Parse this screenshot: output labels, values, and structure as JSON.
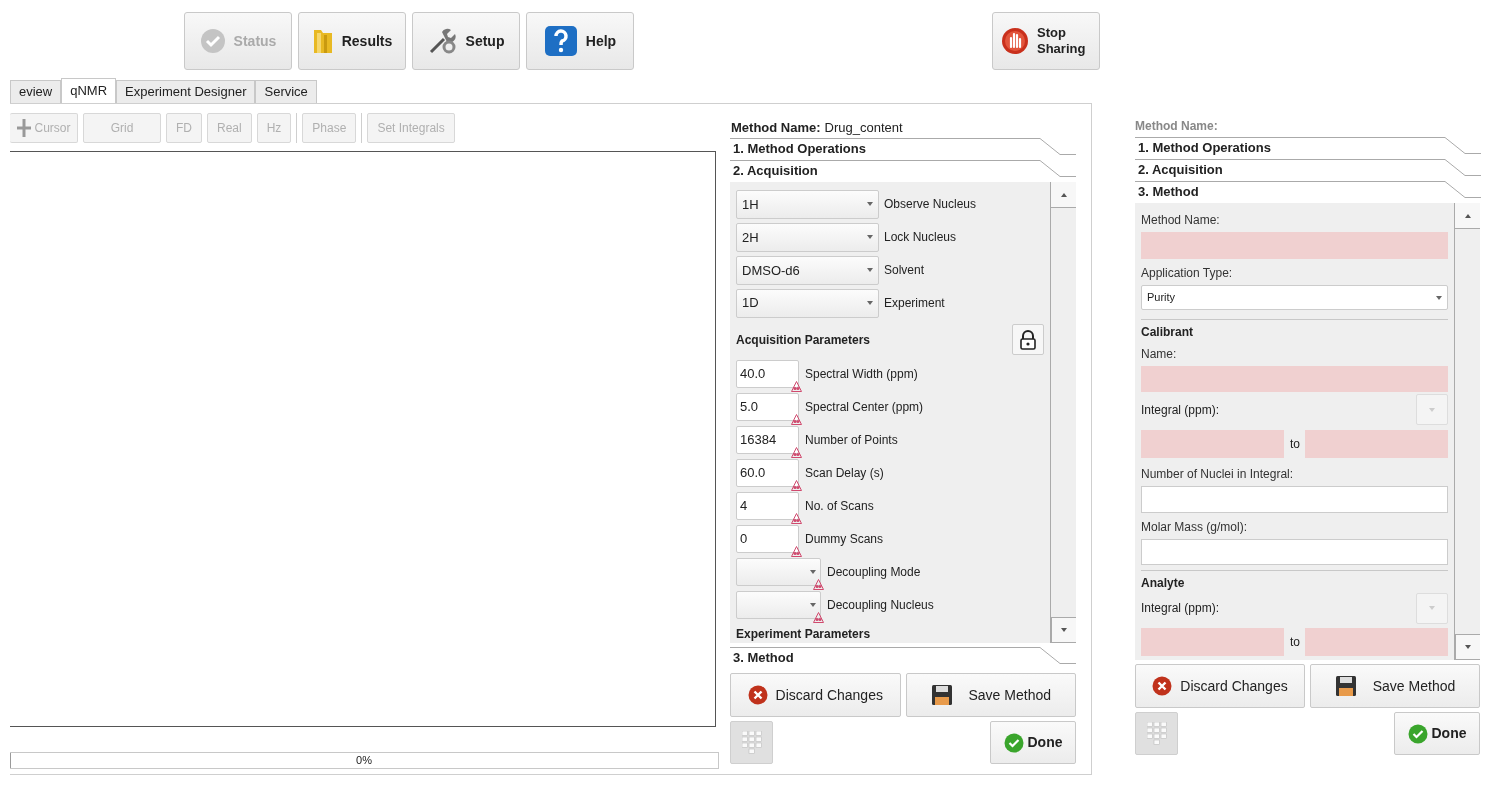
{
  "top_buttons": [
    {
      "kind": "status",
      "label": "Status",
      "disabled": true
    },
    {
      "kind": "results",
      "label": "Results",
      "disabled": false
    },
    {
      "kind": "setup",
      "label": "Setup",
      "disabled": false
    },
    {
      "kind": "help",
      "label": "Help",
      "disabled": false
    }
  ],
  "stop_sharing": {
    "label": "Stop Sharing"
  },
  "tabs": [
    {
      "label": "eview",
      "selected": false
    },
    {
      "label": "qNMR",
      "selected": true
    },
    {
      "label": "Experiment Designer",
      "selected": false
    },
    {
      "label": "Service",
      "selected": false
    }
  ],
  "toolbar": [
    {
      "kind": "cursor",
      "label": "Cursor",
      "disabled": true,
      "separator_before": false
    },
    {
      "kind": "plain",
      "label": "Grid",
      "disabled": true,
      "separator_before": false
    },
    {
      "kind": "plain",
      "label": "FD",
      "disabled": true,
      "separator_before": false
    },
    {
      "kind": "plain",
      "label": "Real",
      "disabled": true,
      "separator_before": false
    },
    {
      "kind": "plain",
      "label": "Hz",
      "disabled": true,
      "separator_before": false
    },
    {
      "kind": "plain",
      "label": "Phase",
      "disabled": true,
      "separator_before": true
    },
    {
      "kind": "plain",
      "label": "Set Integrals",
      "disabled": true,
      "separator_before": true
    }
  ],
  "progress": {
    "level": 0,
    "reading": "0%"
  },
  "method_panel": {
    "name_label": "Method Name:",
    "name_value": "Drug_content",
    "sections_top": [
      "1. Method Operations",
      "2. Acquisition"
    ],
    "selectors": [
      {
        "value": "1H",
        "label": "Observe Nucleus"
      },
      {
        "value": "2H",
        "label": "Lock Nucleus"
      },
      {
        "value": "DMSO-d6",
        "label": "Solvent"
      },
      {
        "value": "1D",
        "label": "Experiment"
      }
    ],
    "params_heading": "Acquisition Parameters",
    "params": [
      {
        "kind": "number",
        "value": "40.0",
        "label": "Spectral Width (ppm)"
      },
      {
        "kind": "number",
        "value": "5.0",
        "label": "Spectral Center (ppm)"
      },
      {
        "kind": "number",
        "value": "16384",
        "label": "Number of Points"
      },
      {
        "kind": "number",
        "value": "60.0",
        "label": "Scan Delay (s)"
      },
      {
        "kind": "number",
        "value": "4",
        "label": "No. of Scans"
      },
      {
        "kind": "number",
        "value": "0",
        "label": "Dummy Scans"
      },
      {
        "kind": "dropdown",
        "label": "Decoupling Mode"
      },
      {
        "kind": "dropdown",
        "label": "Decoupling Nucleus"
      }
    ],
    "next_heading": "Experiment Parameters",
    "sections_bottom": [
      "3. Method"
    ],
    "buttons": [
      {
        "kind": "discard",
        "label": "Discard Changes"
      },
      {
        "kind": "save",
        "label": "Save Method"
      }
    ],
    "done": "Done"
  },
  "method_editor": {
    "name_label": "Method Name:",
    "sections": [
      "1. Method Operations",
      "2. Acquisition",
      "3. Method"
    ],
    "form": [
      {
        "kind": "label",
        "text": "Method Name:"
      },
      {
        "kind": "field",
        "required": true
      },
      {
        "kind": "label",
        "text": "Application Type:"
      },
      {
        "kind": "dropdown",
        "value": "Purity"
      },
      {
        "kind": "divider"
      },
      {
        "kind": "heading",
        "text": "Calibrant"
      },
      {
        "kind": "label",
        "text": "Name:"
      },
      {
        "kind": "field",
        "required": true
      },
      {
        "kind": "integral",
        "text": "Integral (ppm):"
      },
      {
        "kind": "range",
        "joiner": "to",
        "required": true
      },
      {
        "kind": "label",
        "text": "Number of Nuclei in Integral:"
      },
      {
        "kind": "field",
        "required": false
      },
      {
        "kind": "label",
        "text": "Molar Mass (g/mol):"
      },
      {
        "kind": "field",
        "required": false
      },
      {
        "kind": "divider"
      },
      {
        "kind": "heading",
        "text": "Analyte"
      },
      {
        "kind": "integral",
        "text": "Integral (ppm):"
      },
      {
        "kind": "range",
        "joiner": "to",
        "required": true
      }
    ],
    "buttons": [
      {
        "kind": "discard",
        "label": "Discard Changes"
      },
      {
        "kind": "save",
        "label": "Save Method"
      }
    ],
    "done": "Done"
  }
}
